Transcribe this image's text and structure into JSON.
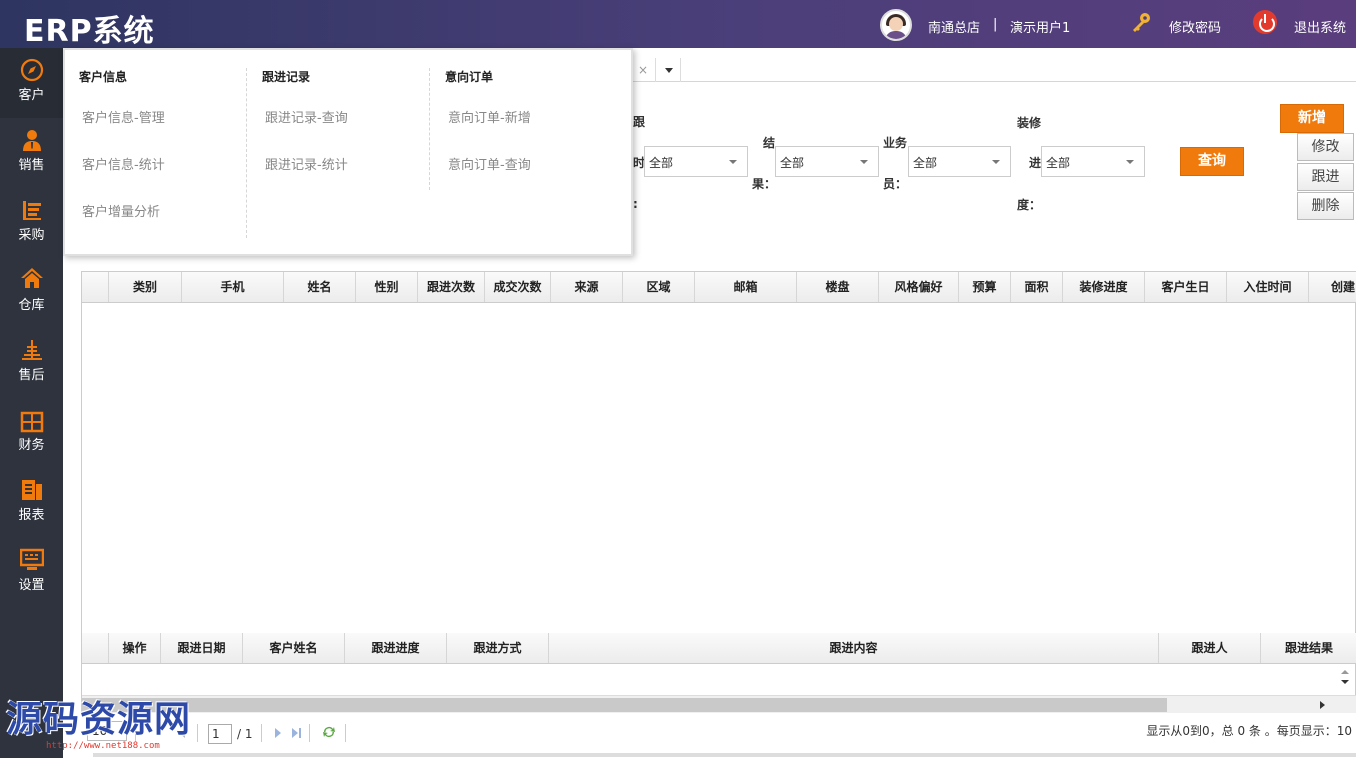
{
  "header": {
    "app_title": "ERP系统",
    "store": "南通总店",
    "separator": "|",
    "user": "演示用户1",
    "change_password": "修改密码",
    "logout": "退出系统"
  },
  "sidebar": {
    "items": [
      {
        "label": "客户",
        "icon": "compass-icon"
      },
      {
        "label": "销售",
        "icon": "user-sale-icon"
      },
      {
        "label": "采购",
        "icon": "cart-icon"
      },
      {
        "label": "仓库",
        "icon": "warehouse-icon"
      },
      {
        "label": "售后",
        "icon": "service-icon"
      },
      {
        "label": "财务",
        "icon": "finance-icon"
      },
      {
        "label": "报表",
        "icon": "report-icon"
      },
      {
        "label": "设置",
        "icon": "settings-icon"
      }
    ]
  },
  "mega_menu": {
    "columns": [
      {
        "title": "客户信息",
        "links": [
          "客户信息-管理",
          "客户信息-统计",
          "客户增量分析"
        ]
      },
      {
        "title": "跟进记录",
        "links": [
          "跟进记录-查询",
          "跟进记录-统计"
        ]
      },
      {
        "title": "意向订单",
        "links": [
          "意向订单-新增",
          "意向订单-查询"
        ]
      }
    ]
  },
  "tabs": {
    "close": "×"
  },
  "filters": {
    "gen_label_top": "跟",
    "gen_label_mid": "时",
    "gen_label_bot": ":",
    "gen_value": "全部",
    "result_label_top": "结",
    "result_label_bot": "果：",
    "result_value": "全部",
    "staff_label_top": "业务",
    "staff_label_bot": "员：",
    "staff_value": "全部",
    "deco_label_top": "装修",
    "deco_label_mid": "进",
    "deco_label_bot": "度：",
    "deco_value": "全部",
    "query_button": "查询"
  },
  "actions": {
    "add": "新增",
    "edit": "修改",
    "follow": "跟进",
    "delete": "删除"
  },
  "main_table": {
    "columns": [
      "类别",
      "手机",
      "姓名",
      "性别",
      "跟进次数",
      "成交次数",
      "来源",
      "区域",
      "邮箱",
      "楼盘",
      "风格偏好",
      "预算",
      "面积",
      "装修进度",
      "客户生日",
      "入住时间",
      "创建"
    ]
  },
  "follow_table": {
    "columns": [
      "操作",
      "跟进日期",
      "客户姓名",
      "跟进进度",
      "跟进方式",
      "跟进内容",
      "跟进人",
      "跟进结果"
    ]
  },
  "pager": {
    "page_size": "10",
    "current_page": "1",
    "total_pages": "/ 1",
    "info": "显示从0到0，总 0 条 。每页显示：10"
  },
  "watermark": {
    "text": "源码资源网",
    "url": "http://www.net188.com"
  },
  "colors": {
    "header_start": "#2e3560",
    "header_end": "#5a3d7c",
    "sidebar_bg": "#2e333d",
    "accent_orange": "#f07b0c"
  }
}
